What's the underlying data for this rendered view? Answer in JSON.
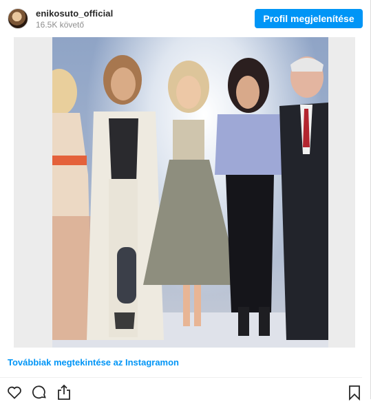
{
  "header": {
    "username": "enikosuto_official",
    "followers": "16.5K követő",
    "profile_button": "Profil megjelenítése"
  },
  "media": {
    "image_icon": "photo-of-five-people"
  },
  "footer": {
    "more_link": "Továbbiak megtekintése az Instagramon"
  },
  "actions": {
    "icons": [
      "heart-icon",
      "comment-icon",
      "share-icon",
      "bookmark-icon"
    ]
  },
  "colors": {
    "accent": "#0095f6",
    "text": "#262626",
    "muted": "#8e8e8e"
  }
}
